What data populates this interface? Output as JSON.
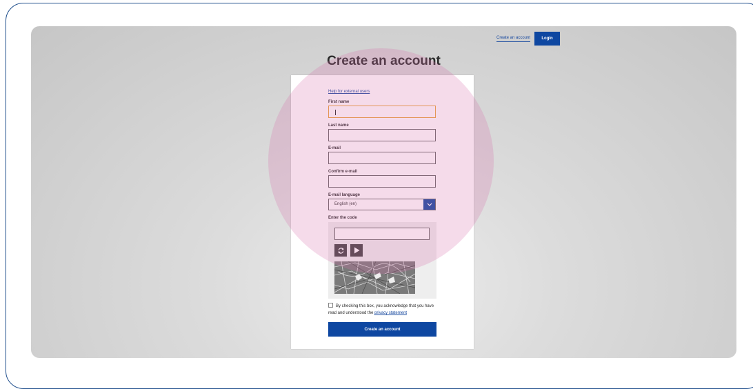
{
  "nav": {
    "create_account_link": "Create an account",
    "login_button": "Login"
  },
  "page": {
    "title": "Create an account"
  },
  "form": {
    "help_link": "Help for external users",
    "first_name_label": "First name",
    "last_name_label": "Last name",
    "email_label": "E-mail",
    "confirm_email_label": "Confirm e-mail",
    "email_language_label": "E-mail language",
    "email_language_value": "English (en)",
    "code_label": "Enter the code",
    "consent_text": "By checking this box, you acknowledge that you have read and understood the ",
    "privacy_link": "privacy statement",
    "submit_label": "Create an account"
  },
  "icons": {
    "refresh": "refresh-icon",
    "play": "play-icon",
    "chevron": "chevron-down-icon"
  },
  "colors": {
    "primary_blue": "#0e47a1",
    "focus_orange": "#e8a33b",
    "highlight_pink": "#d76eaa"
  }
}
